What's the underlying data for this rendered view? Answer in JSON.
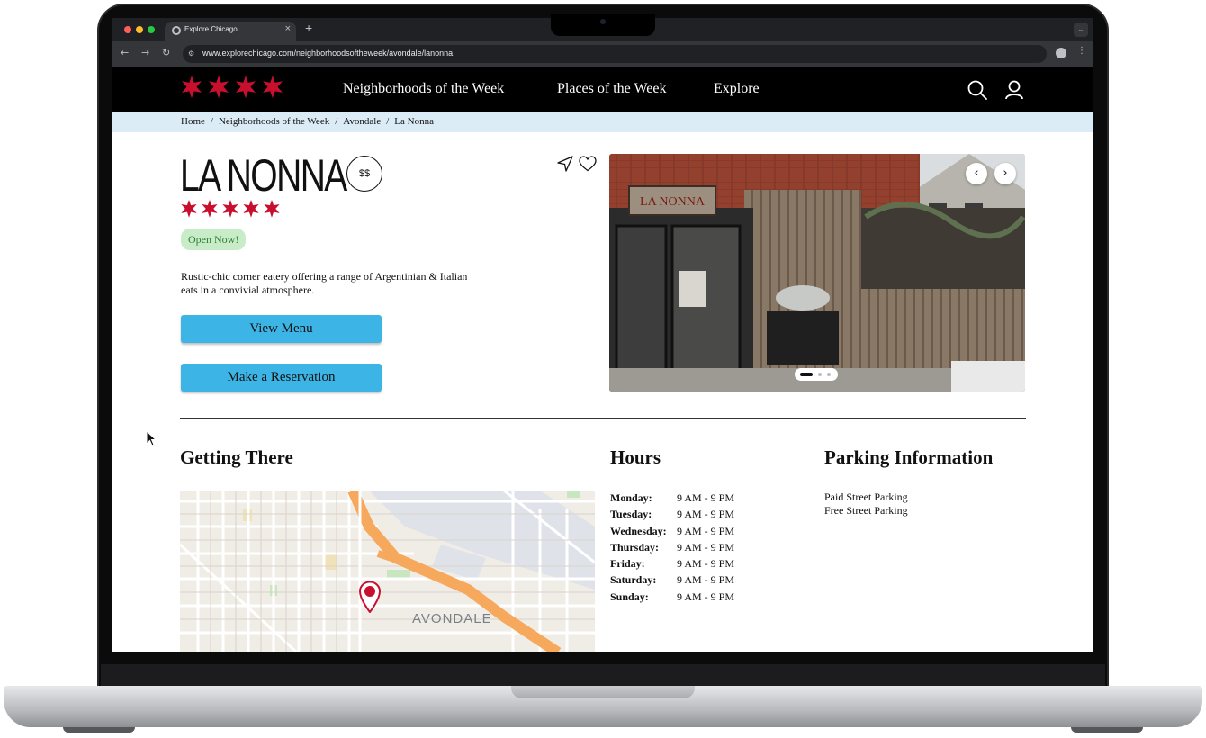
{
  "browser": {
    "tab_title": "Explore Chicago",
    "tab_close": "×",
    "new_tab": "+",
    "url": "www.explorechicago.com/neighborhoodsoftheweek/avondale/lanonna"
  },
  "nav": {
    "links": [
      "Neighborhoods of the Week",
      "Places of the Week",
      "Explore"
    ],
    "icons": [
      "search-icon",
      "user-icon"
    ]
  },
  "breadcrumb": {
    "items": [
      "Home",
      "Neighborhoods of the Week",
      "Avondale",
      "La Nonna"
    ],
    "separator": "/"
  },
  "restaurant": {
    "name": "LA NONNA",
    "price": "$$",
    "rating": 5,
    "rating_max": 5,
    "status": "Open Now!",
    "description": "Rustic-chic corner eatery offering a range of Argentinian & Italian eats in a convivial atmosphere.",
    "view_menu_label": "View Menu",
    "reservation_label": "Make a Reservation"
  },
  "carousel": {
    "slide_count": 3,
    "active_slide": 1,
    "prev_glyph": "‹",
    "next_glyph": "›",
    "sign_text": "LA NONNA"
  },
  "getting_there": {
    "heading": "Getting There",
    "map_label": "AVONDALE"
  },
  "hours": {
    "heading": "Hours",
    "rows": [
      {
        "day": "Monday:",
        "time": "9 AM - 9 PM"
      },
      {
        "day": "Tuesday:",
        "time": "9 AM - 9 PM"
      },
      {
        "day": "Wednesday:",
        "time": "9 AM - 9 PM"
      },
      {
        "day": "Thursday:",
        "time": "9 AM - 9 PM"
      },
      {
        "day": "Friday:",
        "time": "9 AM - 9 PM"
      },
      {
        "day": "Saturday:",
        "time": "9 AM - 9 PM"
      },
      {
        "day": "Sunday:",
        "time": "9 AM - 9 PM"
      }
    ]
  },
  "parking": {
    "heading": "Parking Information",
    "items": [
      "Paid Street Parking",
      "Free Street Parking"
    ]
  },
  "colors": {
    "brand_red": "#c8102e",
    "nav_bg": "#000000",
    "breadcrumb_bg": "#dcecf6",
    "button_blue": "#3cb4e6",
    "open_badge": "#c8ecc8"
  }
}
